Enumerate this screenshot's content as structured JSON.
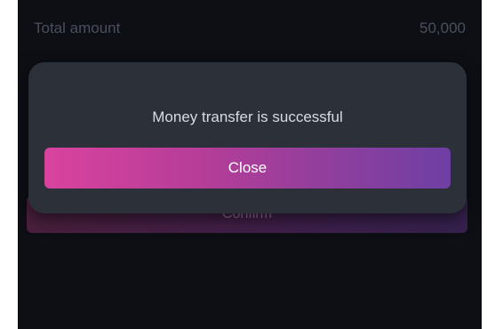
{
  "summary": {
    "total_label": "Total amount",
    "total_value": "50,000"
  },
  "background": {
    "confirm_label": "Confirm"
  },
  "dialog": {
    "message": "Money transfer is successful",
    "close_label": "Close"
  },
  "colors": {
    "screen_bg": "#0d0f15",
    "dialog_bg": "#2c3039",
    "button_gradient_start": "#d9439e",
    "button_gradient_end": "#6e3fa3"
  }
}
